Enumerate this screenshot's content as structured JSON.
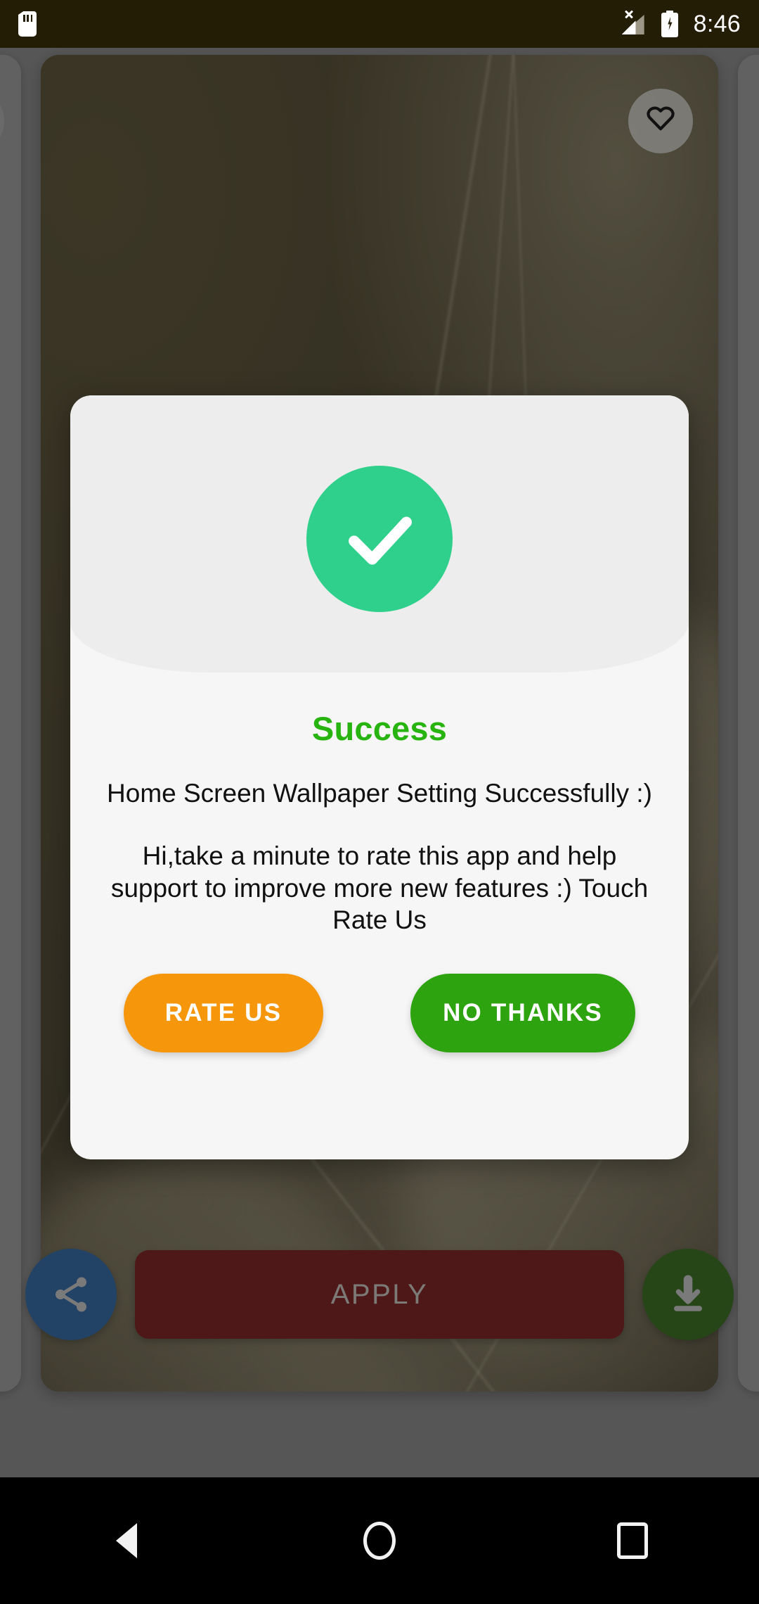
{
  "status_bar": {
    "time": "8:46",
    "icons": {
      "sd_card": "sd-card-icon",
      "signal": "no-sim-signal-icon",
      "battery": "battery-charging-icon"
    }
  },
  "wallpaper_screen": {
    "favorite_icon": "heart-outline-icon",
    "action_bar": {
      "share_icon": "share-icon",
      "apply_label": "APPLY",
      "download_icon": "download-icon"
    }
  },
  "dialog": {
    "status_icon": "check-circle-icon",
    "title": "Success",
    "message": "Home Screen Wallpaper Setting Successfully :)",
    "subtext": "Hi,take a minute to rate this app and help support to improve more new features :) Touch Rate Us",
    "buttons": {
      "rate_us": "RATE US",
      "no_thanks": "NO THANKS"
    },
    "colors": {
      "title": "#28b410",
      "badge": "#2ed08b",
      "rate_us": "#f6960a",
      "no_thanks": "#2ea310",
      "surface": "#f6f6f6",
      "header_surface": "#ededed"
    }
  },
  "nav_bar": {
    "back_icon": "back-triangle-icon",
    "home_icon": "home-circle-icon",
    "recents_icon": "recents-square-icon"
  }
}
